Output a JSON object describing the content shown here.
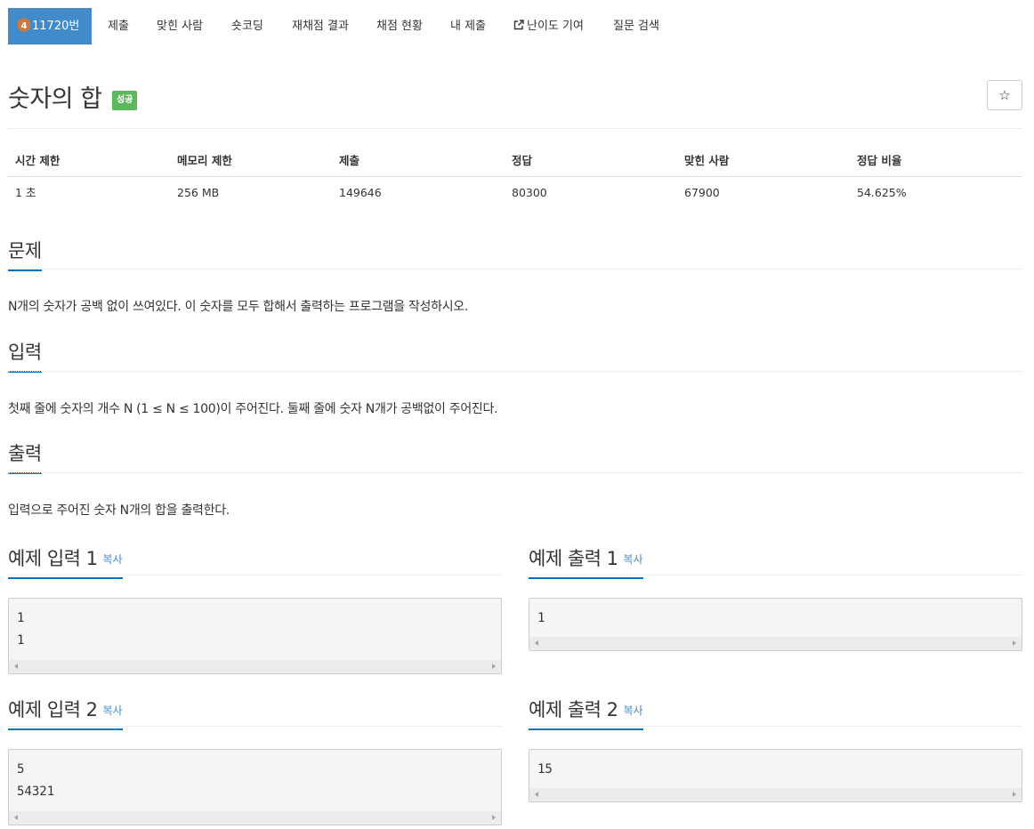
{
  "nav": {
    "problem_number": "11720번",
    "level_badge": "4",
    "items": [
      "제출",
      "맞힌 사람",
      "숏코딩",
      "재채점 결과",
      "채점 현황",
      "내 제출",
      "난이도 기여",
      "질문 검색"
    ]
  },
  "problem": {
    "title": "숫자의 합",
    "status": "성공",
    "star_icon": "☆"
  },
  "info": {
    "headers": [
      "시간 제한",
      "메모리 제한",
      "제출",
      "정답",
      "맞힌 사람",
      "정답 비율"
    ],
    "values": [
      "1 초",
      "256 MB",
      "149646",
      "80300",
      "67900",
      "54.625%"
    ]
  },
  "sections": {
    "description": {
      "title": "문제",
      "text": "N개의 숫자가 공백 없이 쓰여있다. 이 숫자를 모두 합해서 출력하는 프로그램을 작성하시오."
    },
    "input": {
      "title": "입력",
      "text": "첫째 줄에 숫자의 개수 N (1 ≤ N ≤ 100)이 주어진다. 둘째 줄에 숫자 N개가 공백없이 주어진다."
    },
    "output": {
      "title": "출력",
      "text": "입력으로 주어진 숫자 N개의 합을 출력한다."
    }
  },
  "samples": {
    "copy_label": "복사",
    "input1": {
      "title": "예제 입력 1",
      "lines": [
        "1",
        "1"
      ]
    },
    "output1": {
      "title": "예제 출력 1",
      "lines": [
        "1"
      ]
    },
    "input2": {
      "title": "예제 입력 2",
      "lines": [
        "5",
        "54321"
      ]
    },
    "output2": {
      "title": "예제 출력 2",
      "lines": [
        "15"
      ]
    }
  },
  "colors": {
    "nav_active": "#428bca",
    "status_success": "#5cb85c",
    "section_underline": "#0076c0",
    "level_badge": "#d07a3a"
  }
}
